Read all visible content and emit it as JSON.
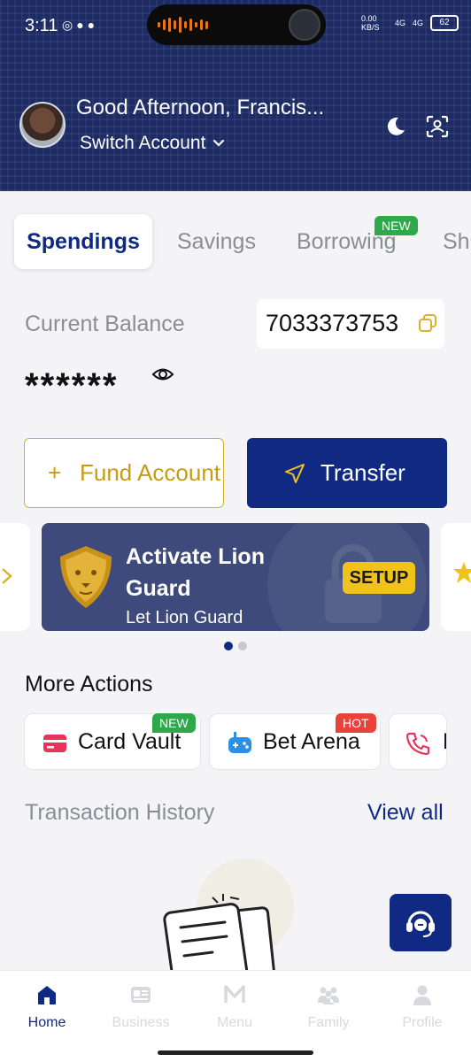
{
  "status_bar": {
    "time": "3:11",
    "network_speed": "0.00 KB/S",
    "signal_1": "4G",
    "signal_2": "4G",
    "battery": "62"
  },
  "header": {
    "greeting": "Good Afternoon,  Francis...",
    "switch_account": "Switch Account",
    "icons": [
      "moon-icon",
      "scan-icon"
    ]
  },
  "tabs": [
    {
      "label": "Spendings",
      "active": true
    },
    {
      "label": "Savings",
      "active": false
    },
    {
      "label": "Borrowing",
      "active": false,
      "badge": "NEW"
    },
    {
      "label": "Sh",
      "active": false
    }
  ],
  "balance": {
    "label": "Current Balance",
    "account_number": "7033373753",
    "masked_amount": "******"
  },
  "buttons": {
    "fund_plus": "+",
    "fund_account": "Fund Account",
    "transfer": "Transfer"
  },
  "banner": {
    "title": "Activate Lion Guard",
    "subtitle": "Let Lion Guard",
    "setup": "SETUP"
  },
  "carousel": {
    "pages": 2,
    "active": 1
  },
  "more_actions": {
    "title": "More Actions",
    "items": [
      {
        "label": "Card Vault",
        "badge": "NEW",
        "icon": "card-icon"
      },
      {
        "label": "Bet Arena",
        "badge": "HOT",
        "icon": "gamepad-icon"
      },
      {
        "label": "E",
        "icon": "phone-icon"
      }
    ]
  },
  "transactions": {
    "title": "Transaction History",
    "view_all": "View all"
  },
  "bottom_nav": [
    {
      "label": "Home",
      "active": true,
      "icon": "home-icon"
    },
    {
      "label": "Business",
      "active": false,
      "icon": "business-icon"
    },
    {
      "label": "Menu",
      "active": false,
      "icon": "menu-logo-icon"
    },
    {
      "label": "Family",
      "active": false,
      "icon": "family-icon"
    },
    {
      "label": "Profile",
      "active": false,
      "icon": "profile-icon"
    }
  ],
  "colors": {
    "brand_navy": "#102a83",
    "header_bg": "#1c2b63",
    "gold": "#d9b12c",
    "new_badge": "#2ea84a",
    "hot_badge": "#e8433a"
  }
}
